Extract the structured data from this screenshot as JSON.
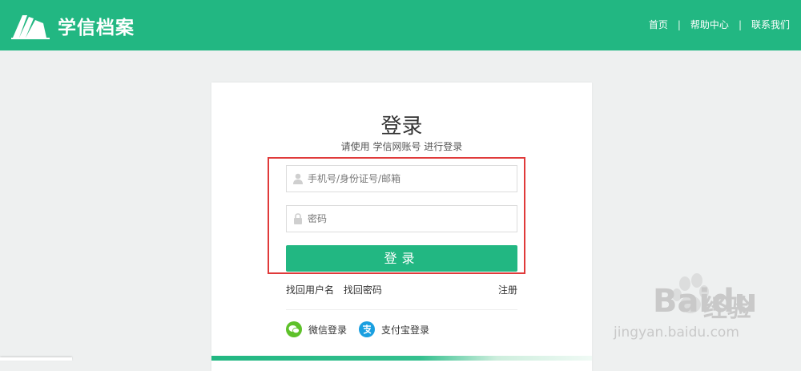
{
  "header": {
    "logo_text": "学信档案",
    "nav": [
      "首页",
      "帮助中心",
      "联系我们"
    ],
    "separator": "|"
  },
  "login": {
    "title": "登录",
    "subtitle": "请使用 学信网账号 进行登录",
    "username_placeholder": "手机号/身份证号/邮箱",
    "password_placeholder": "密码",
    "button": "登录",
    "find_username": "找回用户名",
    "find_password": "找回密码",
    "register": "注册",
    "wechat": "微信登录",
    "alipay": "支付宝登录"
  },
  "watermark": {
    "brand": "Bai",
    "brand2": "du",
    "cn": "经验",
    "url": "jingyan.baidu.com"
  },
  "colors": {
    "brand": "#22b782",
    "highlight": "#e03a3a",
    "wechat": "#5ec12a",
    "alipay": "#1a9fe0"
  },
  "icons": [
    "logo-icon",
    "user-icon",
    "lock-icon",
    "wechat-icon",
    "alipay-icon",
    "paw-icon"
  ]
}
